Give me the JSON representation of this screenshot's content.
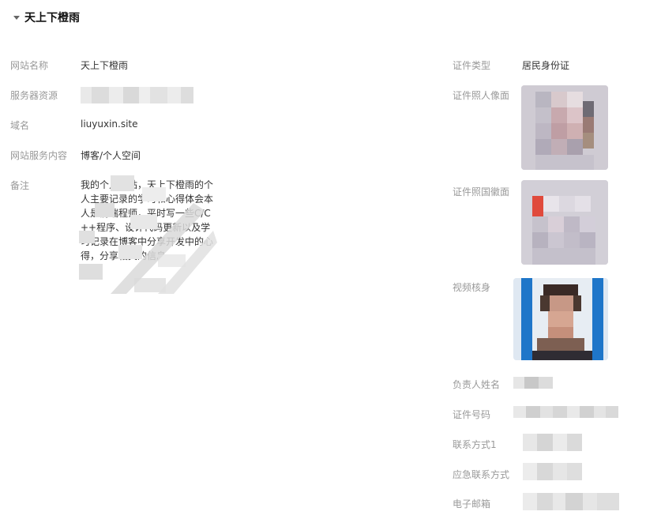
{
  "section": {
    "title": "天上下橙雨"
  },
  "left": {
    "site_name_label": "网站名称",
    "site_name_value": "天上下橙雨",
    "server_label": "服务器资源",
    "domain_label": "域名",
    "domain_value": "liuyuxin.site",
    "content_label": "网站服务内容",
    "content_value": "博客/个人空间",
    "remark_label": "备注",
    "remark_value": "我的个人网站，天上下橙雨的个人主要记录的学习和心得体会本人是前端程师，平时写一些C/C++程序、设计代码更新以及学习记录在博客中分享开发中的心得，分享相关的信息。"
  },
  "right": {
    "cert_type_label": "证件类型",
    "cert_type_value": "居民身份证",
    "cert_front_label": "证件照人像面",
    "cert_back_label": "证件照国徽面",
    "video_label": "视频核身",
    "person_name_label": "负责人姓名",
    "cert_no_label": "证件号码",
    "contact1_label": "联系方式1",
    "emergency_label": "应急联系方式",
    "email_label": "电子邮箱"
  },
  "colors": {
    "blur": "#d4d4d4",
    "blur_light": "#e6e6e6",
    "blue": "#1f76c9"
  }
}
